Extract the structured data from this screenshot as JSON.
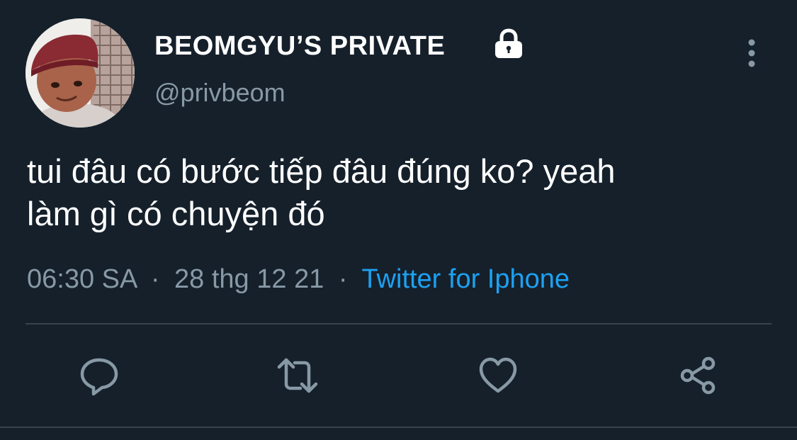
{
  "user": {
    "display_name": "BEOMGYU’S PRIVATE",
    "handle": "@privbeom",
    "protected_icon": "lock-icon",
    "avatar_icon": "avatar"
  },
  "header": {
    "more_icon": "more-vertical-icon"
  },
  "tweet": {
    "text_line1": "tui đâu có bước tiếp đâu đúng ko? yeah",
    "text_line2": "làm gì có chuyện đó"
  },
  "meta": {
    "time": "06:30 SA",
    "separator1": "·",
    "date": "28 thg 12 21",
    "separator2": "·",
    "source": "Twitter for Iphone"
  },
  "actions": {
    "reply_icon": "reply-icon",
    "retweet_icon": "retweet-icon",
    "like_icon": "heart-icon",
    "share_icon": "share-icon"
  },
  "colors": {
    "background": "#15202b",
    "text": "#ffffff",
    "secondary": "#8899a6",
    "accent": "#1da1f2",
    "divider": "#38444d"
  }
}
